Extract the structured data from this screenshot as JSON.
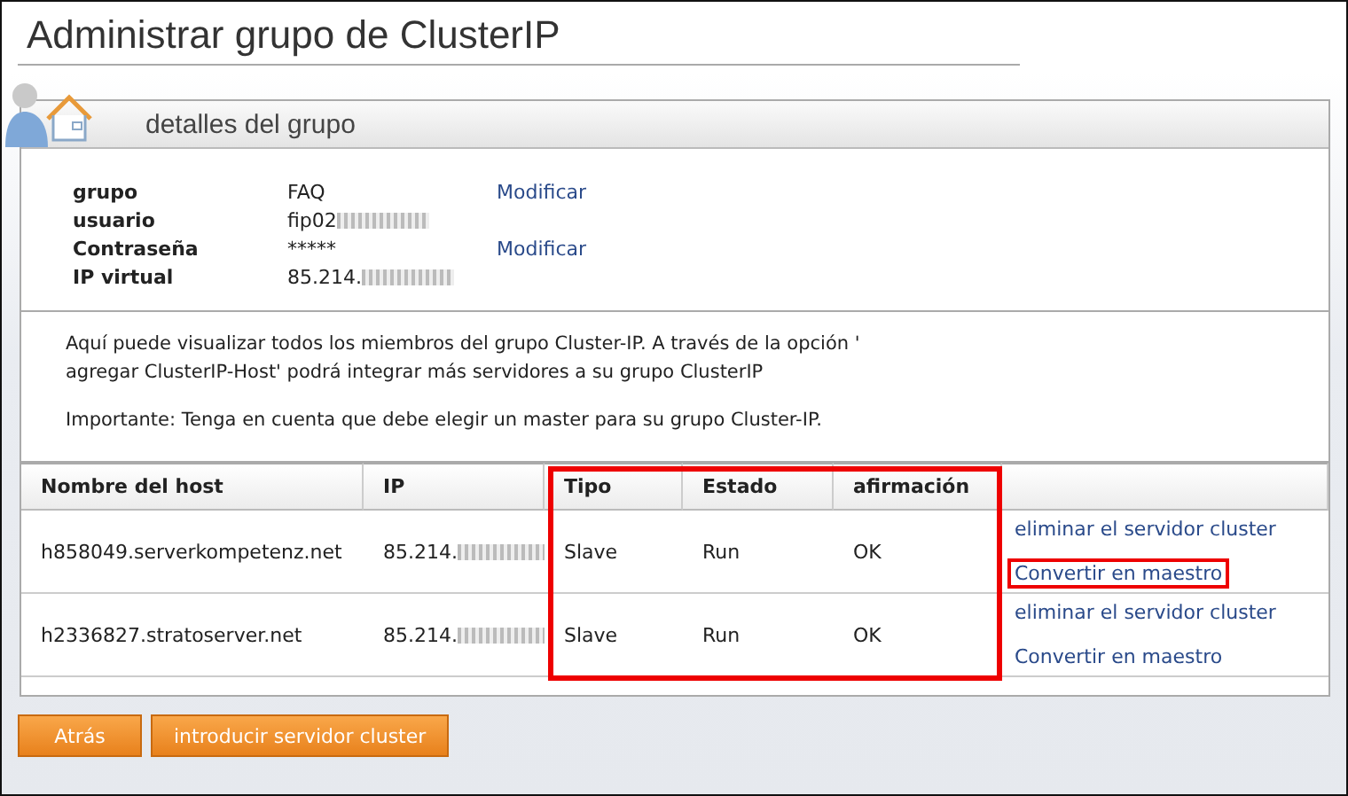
{
  "page_title": "Administrar grupo de ClusterIP",
  "panel": {
    "title": "detalles del grupo",
    "details": [
      {
        "label": "grupo",
        "value": "FAQ",
        "redacted": false,
        "action": "Modificar"
      },
      {
        "label": "usuario",
        "value": "fip02",
        "redacted": true
      },
      {
        "label": "Contraseña",
        "value": "*****",
        "redacted": false,
        "action": "Modificar"
      },
      {
        "label": "IP virtual",
        "value": "85.214.",
        "redacted": true
      }
    ],
    "info": [
      "Aquí puede visualizar todos los miembros del grupo Cluster-IP. A través de la opción '",
      "agregar ClusterIP-Host' podrá integrar más servidores a su grupo ClusterIP"
    ],
    "notice": "Importante: Tenga en cuenta que debe elegir un master para su grupo Cluster-IP.",
    "table": {
      "columns": [
        {
          "label": "Nombre del host",
          "highlighted": false
        },
        {
          "label": "IP",
          "highlighted": false
        },
        {
          "label": "Tipo",
          "highlighted": true
        },
        {
          "label": "Estado",
          "highlighted": true
        },
        {
          "label": "afirmación",
          "highlighted": true
        }
      ],
      "rows": [
        {
          "cells": [
            "h858049.serverkompetenz.net",
            "85.214.",
            "Slave",
            "Run",
            "OK"
          ],
          "ip_redacted": true,
          "actions": [
            {
              "label": "eliminar el servidor cluster",
              "highlighted": false
            },
            {
              "label": "Convertir en maestro",
              "highlighted": true
            }
          ]
        },
        {
          "cells": [
            "h2336827.stratoserver.net",
            "85.214.",
            "Slave",
            "Run",
            "OK"
          ],
          "ip_redacted": true,
          "actions": [
            {
              "label": "eliminar el servidor cluster",
              "highlighted": false
            },
            {
              "label": "Convertir en maestro",
              "highlighted": false
            }
          ]
        }
      ]
    }
  },
  "buttons": [
    "Atrás",
    "introducir servidor cluster"
  ]
}
